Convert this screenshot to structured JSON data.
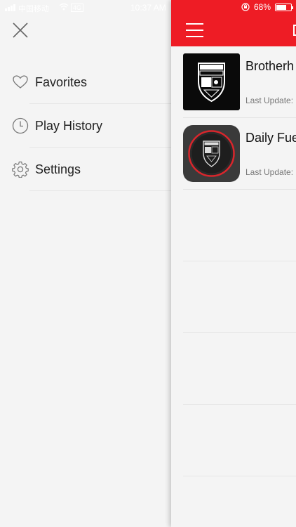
{
  "status_bar": {
    "carrier": "中国移动",
    "network": "4G",
    "time": "10:37 AM",
    "battery_percent": "68%",
    "battery_level": 0.68
  },
  "drawer": {
    "close_icon": "close-icon",
    "items": [
      {
        "label": "Favorites",
        "icon": "heart-icon"
      },
      {
        "label": "Play History",
        "icon": "clock-icon"
      },
      {
        "label": "Settings",
        "icon": "gear-icon"
      }
    ]
  },
  "main": {
    "accent_color": "#ee1c25",
    "items": [
      {
        "title": "Brotherh",
        "meta": "Last Update:"
      },
      {
        "title": "Daily Fue",
        "meta": "Last Update:"
      }
    ]
  }
}
